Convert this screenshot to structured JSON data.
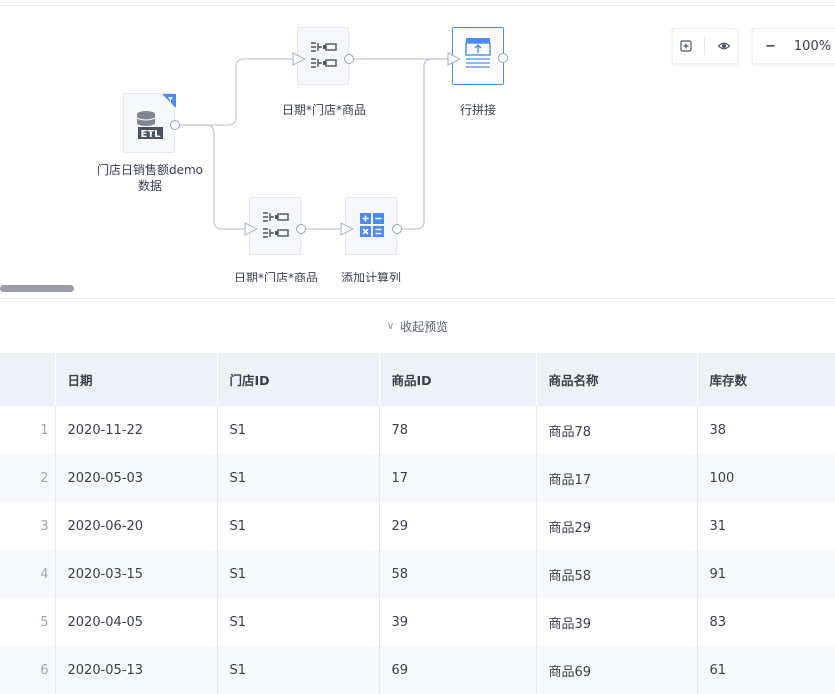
{
  "canvas": {
    "nodes": {
      "source": {
        "label_line1": "门店日销售额demo",
        "label_line2": "数据",
        "icon": "etl-database-icon"
      },
      "group_top": {
        "label": "日期*门店*商品",
        "icon": "group-aggregate-icon"
      },
      "group_bottom": {
        "label": "日期*门店*商品",
        "icon": "group-aggregate-icon"
      },
      "calc": {
        "label": "添加计算列",
        "icon": "calculator-icon"
      },
      "union": {
        "label": "行拼接",
        "icon": "row-union-icon"
      }
    },
    "toolbar": {
      "fit_icon": "fit-view-icon",
      "eye_icon": "eye-icon"
    },
    "zoom": {
      "minus": "−",
      "value": "100%"
    }
  },
  "preview": {
    "toggle_label": "收起预览",
    "chevron": "∨"
  },
  "table": {
    "columns": [
      "日期",
      "门店ID",
      "商品ID",
      "商品名称",
      "库存数"
    ],
    "rows": [
      [
        "1",
        "2020-11-22",
        "S1",
        "78",
        "商品78",
        "38"
      ],
      [
        "2",
        "2020-05-03",
        "S1",
        "17",
        "商品17",
        "100"
      ],
      [
        "3",
        "2020-06-20",
        "S1",
        "29",
        "商品29",
        "31"
      ],
      [
        "4",
        "2020-03-15",
        "S1",
        "58",
        "商品58",
        "91"
      ],
      [
        "5",
        "2020-04-05",
        "S1",
        "39",
        "商品39",
        "83"
      ],
      [
        "6",
        "2020-05-13",
        "S1",
        "69",
        "商品69",
        "61"
      ]
    ]
  },
  "colors": {
    "accent": "#4a8cf7",
    "header_bg": "#eef2f8",
    "alt_row": "#f6f8fb"
  }
}
